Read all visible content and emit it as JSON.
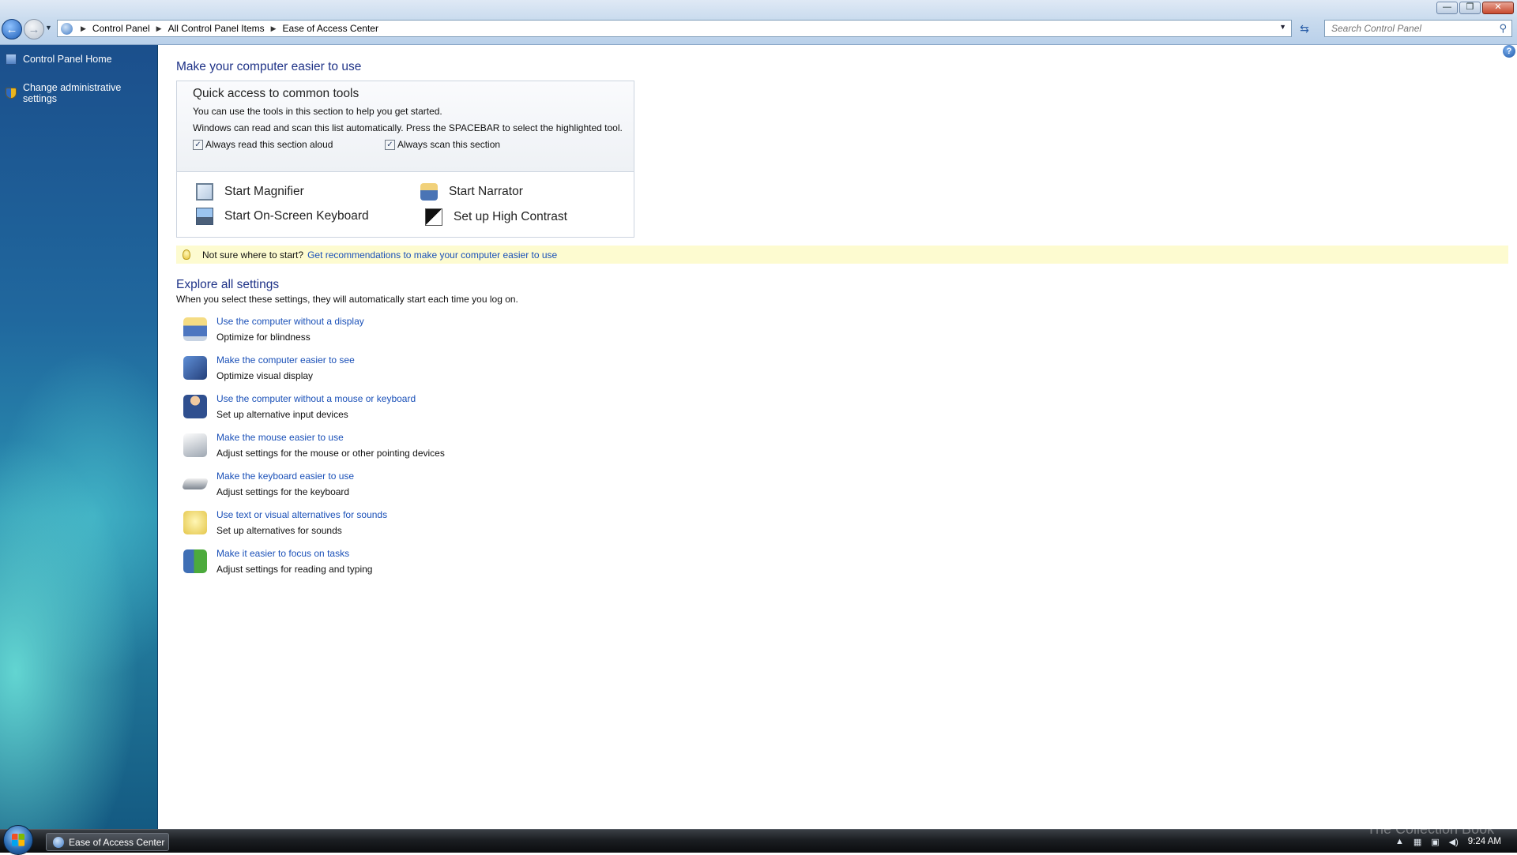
{
  "window": {
    "minimize_glyph": "—",
    "restore_glyph": "❐",
    "close_glyph": "✕"
  },
  "address": {
    "crumbs": [
      "Control Panel",
      "All Control Panel Items",
      "Ease of Access Center"
    ],
    "search_placeholder": "Search Control Panel"
  },
  "sidebar": {
    "items": [
      {
        "label": "Control Panel Home",
        "icon": "control-panel-icon"
      },
      {
        "label": "Change administrative settings",
        "icon": "uac-shield-icon"
      }
    ]
  },
  "main": {
    "title": "Make your computer easier to use",
    "quick": {
      "heading": "Quick access to common tools",
      "line1": "You can use the tools in this section to help you get started.",
      "line2": "Windows can read and scan this list automatically.  Press the SPACEBAR to select the highlighted tool.",
      "read_aloud_label": "Always read this section aloud",
      "read_aloud_checked": true,
      "scan_label": "Always scan this section",
      "scan_checked": true,
      "tools": {
        "magnifier": "Start Magnifier",
        "narrator": "Start Narrator",
        "osk": "Start On-Screen Keyboard",
        "contrast": "Set up High Contrast"
      }
    },
    "tip": {
      "text": "Not sure where to start?",
      "link": "Get recommendations to make your computer easier to use"
    },
    "explore": {
      "heading": "Explore all settings",
      "description": "When you select these settings, they will automatically start each time you log on.",
      "items": [
        {
          "link": "Use the computer without a display",
          "desc": "Optimize for blindness"
        },
        {
          "link": "Make the computer easier to see",
          "desc": "Optimize visual display"
        },
        {
          "link": "Use the computer without a mouse or keyboard",
          "desc": "Set up alternative input devices"
        },
        {
          "link": "Make the mouse easier to use",
          "desc": "Adjust settings for the mouse or other pointing devices"
        },
        {
          "link": "Make the keyboard easier to use",
          "desc": "Adjust settings for the keyboard"
        },
        {
          "link": "Use text or visual alternatives for sounds",
          "desc": "Set up alternatives for sounds"
        },
        {
          "link": "Make it easier to focus on tasks",
          "desc": "Adjust settings for reading and typing"
        }
      ]
    }
  },
  "taskbar": {
    "window_button": "Ease of Access Center",
    "clock": "9:24 AM",
    "watermark": "The Collection Book"
  }
}
